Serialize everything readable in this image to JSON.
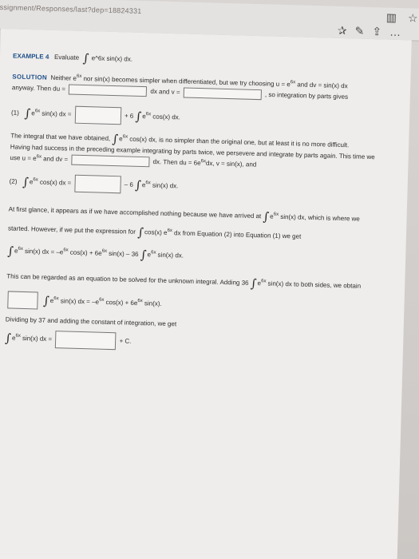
{
  "browser": {
    "address": "ssignment/Responses/last?dep=18824331",
    "icons": [
      "reader-icon",
      "favorite-icon",
      "favorites-bar-icon",
      "pen-icon",
      "share-icon",
      "more-icon"
    ]
  },
  "example": {
    "label": "EXAMPLE 4",
    "evaluate": "Evaluate",
    "expr": "e^6x sin(x) dx."
  },
  "lines": {
    "l1a": "SOLUTION",
    "l1b": "Neither  e",
    "l1c": "  nor  sin(x)  becomes simpler when differentiated, but we try choosing  u = e",
    "l1d": "  and  dv = sin(x) dx",
    "l2a": "anyway. Then  du =",
    "l2b": "dx  and  v =",
    "l2c": ",  so integration by parts gives",
    "l3a": "(1)",
    "l3b": "e",
    "l3c": " sin(x) dx =",
    "l3d": "+ 6",
    "l3e": "e",
    "l3f": " cos(x) dx.",
    "l4a": "The integral that we have obtained,",
    "l4b": "e",
    "l4c": " cos(x) dx,  is no simpler than the original one, but at least it is no more difficult.",
    "l5": "Having had success in the preceding example integrating by parts twice, we persevere and integrate by parts again. This time we",
    "l6a": "use  u = e",
    "l6b": " and  dv =",
    "l6c": "dx.  Then  du = 6e",
    "l6d": "dx,  v = sin(x),  and",
    "l7a": "(2)",
    "l7b": "e",
    "l7c": " cos(x) dx =",
    "l7d": "– 6",
    "l7e": "e",
    "l7f": " sin(x) dx.",
    "l8a": "At first glance, it appears as if we have accomplished nothing because we have arrived at",
    "l8b": "e",
    "l8c": " sin(x) dx,  which is where we",
    "l9a": "started. However, if we put the expression for",
    "l9b": "cos(x) e",
    "l9c": " dx  from Equation (2) into Equation (1) we get",
    "l10a": "e",
    "l10b": " sin(x) dx = –e",
    "l10c": " cos(x) + 6e",
    "l10d": " sin(x) – 36",
    "l10e": "e",
    "l10f": " sin(x) dx.",
    "l11a": "This can be regarded as an equation to be solved for the unknown integral. Adding  36",
    "l11b": "e",
    "l11c": " sin(x) dx  to both sides, we obtain",
    "l12a": "e",
    "l12b": " sin(x) dx = –e",
    "l12c": " cos(x) + 6e",
    "l12d": " sin(x).",
    "l13": "Dividing by 37 and adding the constant of integration, we get",
    "l14a": "e",
    "l14b": " sin(x) dx =",
    "l14c": "+ C.",
    "sup6x": "6x"
  }
}
